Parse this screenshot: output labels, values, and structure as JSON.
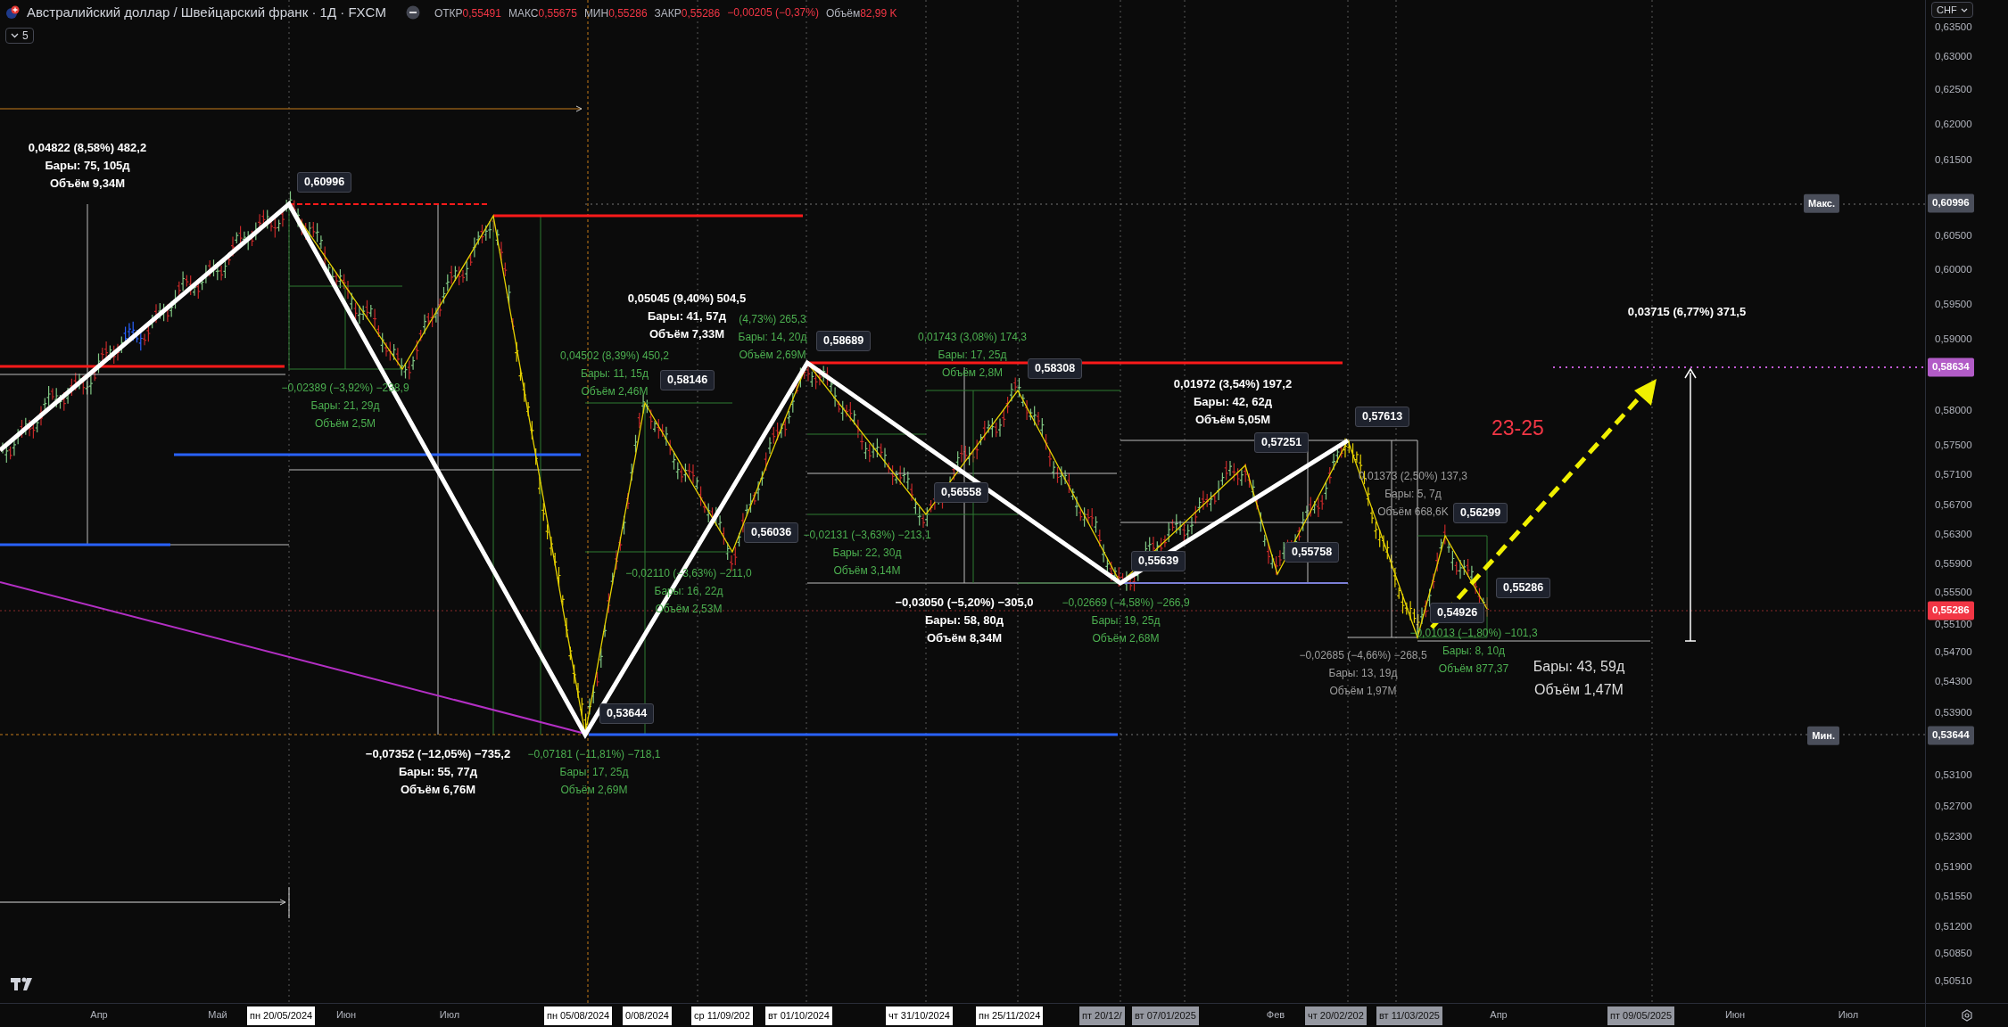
{
  "header": {
    "title": "Австралийский доллар / Швейцарский франк · 1Д · FXCM",
    "quote": [
      {
        "label": "ОТКР",
        "value": "0,55491"
      },
      {
        "label": "МАКС",
        "value": "0,55675"
      },
      {
        "label": "МИН",
        "value": "0,55286"
      },
      {
        "label": "ЗАКР",
        "value": "0,55286"
      }
    ],
    "change": "−0,00205 (−0,37%)",
    "volume": {
      "label": "Объём",
      "value": "82,99 K"
    },
    "indicators_count": "5"
  },
  "price_axis": {
    "currency": "CHF",
    "ticks": [
      "0,63500",
      "0,63000",
      "0,62500",
      "0,62000",
      "0,61500",
      "0,60500",
      "0,60000",
      "0,59500",
      "0,59000",
      "0,58000",
      "0,57500",
      "0,57100",
      "0,56700",
      "0,56300",
      "0,55900",
      "0,55500",
      "0,55100",
      "0,54700",
      "0,54300",
      "0,53900",
      "0,53100",
      "0,52700",
      "0,52300",
      "0,51900",
      "0,51550",
      "0,51200",
      "0,50850",
      "0,50510"
    ],
    "tags": [
      {
        "label": "Макс.",
        "value": "0,60996",
        "color": "#4a4e5a"
      },
      {
        "value": "0,58634",
        "color": "#b25cc7"
      },
      {
        "value": "0,55286",
        "color": "#f23645"
      },
      {
        "label": "Мин.",
        "value": "0,53644",
        "color": "#4a4e5a"
      }
    ]
  },
  "time_axis": [
    {
      "text": "Апр",
      "kind": "month"
    },
    {
      "text": "Май",
      "kind": "month"
    },
    {
      "text": "пн 20/05/2024",
      "kind": "marker"
    },
    {
      "text": "Июн",
      "kind": "month"
    },
    {
      "text": "Июл",
      "kind": "month"
    },
    {
      "text": "пн 05/08/2024",
      "kind": "marker"
    },
    {
      "text": "0/08/2024",
      "kind": "marker"
    },
    {
      "text": "ср 11/09/202",
      "kind": "marker"
    },
    {
      "text": "вт 01/10/2024",
      "kind": "marker"
    },
    {
      "text": "чт 31/10/2024",
      "kind": "marker"
    },
    {
      "text": "пн 25/11/2024",
      "kind": "marker"
    },
    {
      "text": "пт 20/12/",
      "kind": "dim-marker"
    },
    {
      "text": "вт 07/01/2025",
      "kind": "dim-marker"
    },
    {
      "text": "Фев",
      "kind": "month"
    },
    {
      "text": "чт 20/02/202",
      "kind": "dim-marker"
    },
    {
      "text": "вт 11/03/2025",
      "kind": "dim-marker"
    },
    {
      "text": "Апр",
      "kind": "month"
    },
    {
      "text": "пт 09/05/2025",
      "kind": "dim-marker"
    },
    {
      "text": "Июн",
      "kind": "month"
    },
    {
      "text": "Июл",
      "kind": "month"
    }
  ],
  "measurements": [
    {
      "color": "#ffffff",
      "lines": [
        "0,04822 (8,58%) 482,2",
        "Бары: 75, 105д",
        "Объём 9,34M"
      ]
    },
    {
      "color": "#4caf50",
      "lines": [
        "−0,02389 (−3,92%) −238,9",
        "Бары: 21, 29д",
        "Объём 2,5M"
      ]
    },
    {
      "color": "#4caf50",
      "lines": [
        "0,04502 (8,39%) 450,2",
        "Бары: 11, 15д",
        "Объём 2,46M"
      ]
    },
    {
      "color": "#ffffff",
      "lines": [
        "0,05045 (9,40%) 504,5",
        "Бары: 41, 57д",
        "Объём 7,33M"
      ]
    },
    {
      "color": "#4caf50",
      "lines": [
        "(4,73%) 265,3",
        "Бары: 14, 20д",
        "Объём 2,69M"
      ]
    },
    {
      "color": "#4caf50",
      "lines": [
        "−0,02110 (−3,63%) −211,0",
        "Бары: 16, 22д",
        "Объём 2,53M"
      ]
    },
    {
      "color": "#ffffff",
      "lines": [
        "−0,07352 (−12,05%) −735,2",
        "Бары: 55, 77д",
        "Объём 6,76M"
      ]
    },
    {
      "color": "#4caf50",
      "lines": [
        "−0,07181 (−11,81%) −718,1",
        "Бары: 17, 25д",
        "Объём 2,69M"
      ]
    },
    {
      "color": "#4caf50",
      "lines": [
        "0,01743 (3,08%) 174,3",
        "Бары: 17, 25д",
        "Объём 2,8M"
      ]
    },
    {
      "color": "#4caf50",
      "lines": [
        "−0,02131 (−3,63%) −213,1",
        "Бары: 22, 30д",
        "Объём 3,14M"
      ]
    },
    {
      "color": "#ffffff",
      "lines": [
        "−0,03050 (−5,20%) −305,0",
        "Бары: 58, 80д",
        "Объём 8,34M"
      ]
    },
    {
      "color": "#4caf50",
      "lines": [
        "−0,02669 (−4,58%) −266,9",
        "Бары: 19, 25д",
        "Объём 2,68M"
      ]
    },
    {
      "color": "#ffffff",
      "lines": [
        "0,01972 (3,54%) 197,2",
        "Бары: 42, 62д",
        "Объём 5,05M"
      ]
    },
    {
      "color": "#9e9e9e",
      "lines": [
        "0,01373 (2,50%) 137,3",
        "Бары: 5, 7д",
        "Объём 668,6K"
      ]
    },
    {
      "color": "#9e9e9e",
      "lines": [
        "−0,02685 (−4,66%) −268,5",
        "Бары: 13, 19д",
        "Объём 1,97M"
      ]
    },
    {
      "color": "#4caf50",
      "lines": [
        "−0,01013 (−1,80%) −101,3",
        "Бары: 8, 10д",
        "Объём 877,37"
      ]
    },
    {
      "color": "#ffffff",
      "lines": [
        "0,03715 (6,77%) 371,5"
      ]
    },
    {
      "color": "#dddddd",
      "lines": [
        "Бары: 43, 59д",
        "Объём 1,47M"
      ]
    }
  ],
  "price_callouts": [
    "0,60996",
    "0,58146",
    "0,56036",
    "0,53644",
    "0,58689",
    "0,58308",
    "0,56558",
    "0,55639",
    "0,57251",
    "0,55758",
    "0,57613",
    "0,56299",
    "0,55286",
    "0,54926"
  ],
  "note": "23-25"
}
